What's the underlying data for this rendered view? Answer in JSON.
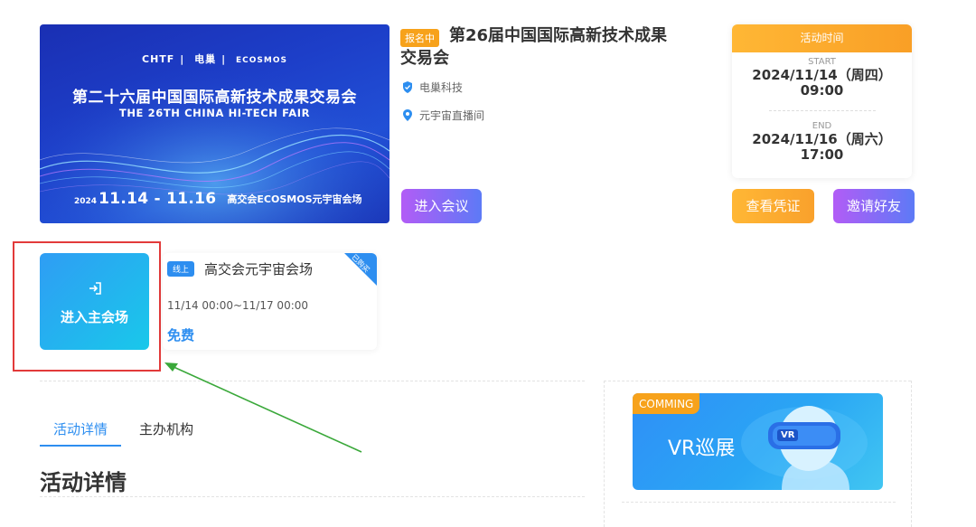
{
  "banner": {
    "logos": [
      "CHTF",
      "电巢",
      "ECOSMOS"
    ],
    "cn_title": "第二十六届中国国际高新技术成果交易会",
    "en_title": "THE 26TH CHINA HI-TECH FAIR",
    "year": "2024",
    "dates": "11.14 - 11.16",
    "venue": "高交会ECOSMOS元宇宙会场"
  },
  "event": {
    "status_badge": "报名中",
    "title": "第26届中国国际高新技术成果交易会",
    "organizer": "电巢科技",
    "location": "元宇宙直播间",
    "enter_button": "进入会议"
  },
  "time_card": {
    "header": "活动时间",
    "start_label": "START",
    "start_date": "2024/11/14（周四）",
    "start_time": "09:00",
    "end_label": "END",
    "end_date": "2024/11/16（周六）",
    "end_time": "17:00"
  },
  "actions": {
    "ticket_button": "查看凭证",
    "invite_button": "邀请好友"
  },
  "main_venue": {
    "enter_label": "进入主会场",
    "online_badge": "线上",
    "name": "高交会元宇宙会场",
    "corner_tag": "已购买",
    "time_range": "11/14 00:00~11/17 00:00",
    "price": "免费"
  },
  "tabs": [
    {
      "label": "活动详情"
    },
    {
      "label": "主办机构"
    }
  ],
  "section_title": "活动详情",
  "vr_card": {
    "tag": "COMMING",
    "title": "VR巡展",
    "headset_label": "VR"
  },
  "colors": {
    "accent_blue": "#2d8ef0",
    "orange": "#f7a21b",
    "purple_gradient_start": "#b25cf6",
    "highlight_red": "#e23a3a",
    "arrow_green": "#3aa83a"
  },
  "icons": {
    "organizer": "shield-check-icon",
    "location": "location-pin-icon",
    "enter": "enter-door-icon"
  }
}
